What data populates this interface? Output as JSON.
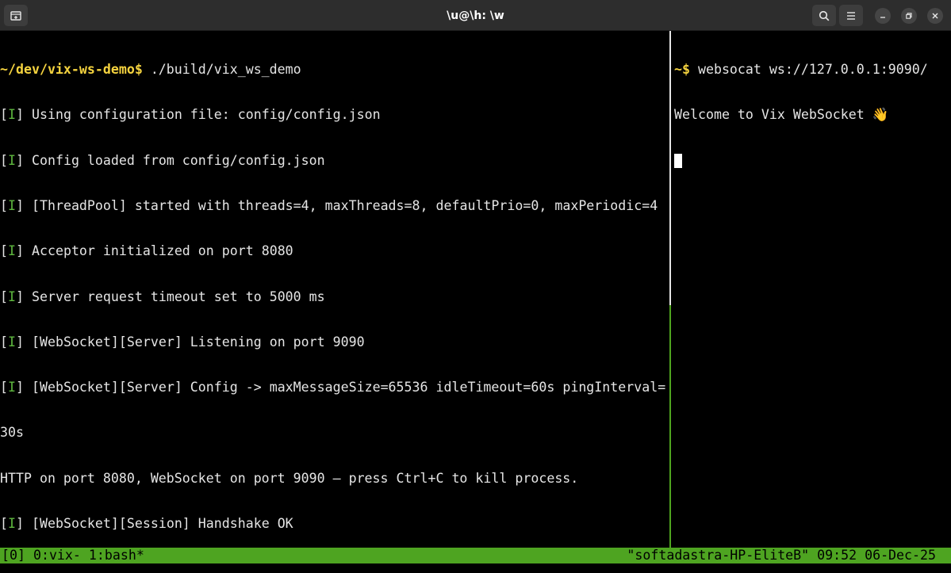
{
  "window": {
    "title": "\\u@\\h: \\w",
    "icons": {
      "new_tab": "new-tab-icon",
      "search": "search-icon",
      "menu": "hamburger-menu-icon",
      "minimize": "minimize-icon",
      "restore": "restore-icon",
      "close": "close-icon"
    }
  },
  "left_pane": {
    "prompt": "~/dev/vix-ws-demo$",
    "command": " ./build/vix_ws_demo",
    "log_lines": [
      {
        "tag": "I",
        "text": " Using configuration file: config/config.json"
      },
      {
        "tag": "I",
        "text": " Config loaded from config/config.json"
      },
      {
        "tag": "I",
        "text": " [ThreadPool] started with threads=4, maxThreads=8, defaultPrio=0, maxPeriodic=4"
      },
      {
        "tag": "I",
        "text": " Acceptor initialized on port 8080"
      },
      {
        "tag": "I",
        "text": " Server request timeout set to 5000 ms"
      },
      {
        "tag": "I",
        "text": " [WebSocket][Server] Listening on port 9090"
      },
      {
        "tag": "I",
        "text": " [WebSocket][Server] Config -> maxMessageSize=65536 idleTimeout=60s pingInterval="
      }
    ],
    "wrap_line": "30s",
    "plain_line": "HTTP on port 8080, WebSocket on port 9090 — press Ctrl+C to kill process.",
    "last_log": {
      "tag": "I",
      "text": " [WebSocket][Session] Handshake OK"
    }
  },
  "right_pane": {
    "prompt": "~$",
    "command": " websocat ws://127.0.0.1:9090/",
    "output": "Welcome to Vix WebSocket 👋"
  },
  "status_bar": {
    "left": "[0] 0:vix- 1:bash*",
    "right": "\"softadastra-HP-EliteB\" 09:52 06-Dec-25"
  },
  "colors": {
    "prompt": "#f5d33f",
    "log_tag": "#5fb83f",
    "status_bg": "#4ea421",
    "titlebar_bg": "#2d2d2d"
  }
}
